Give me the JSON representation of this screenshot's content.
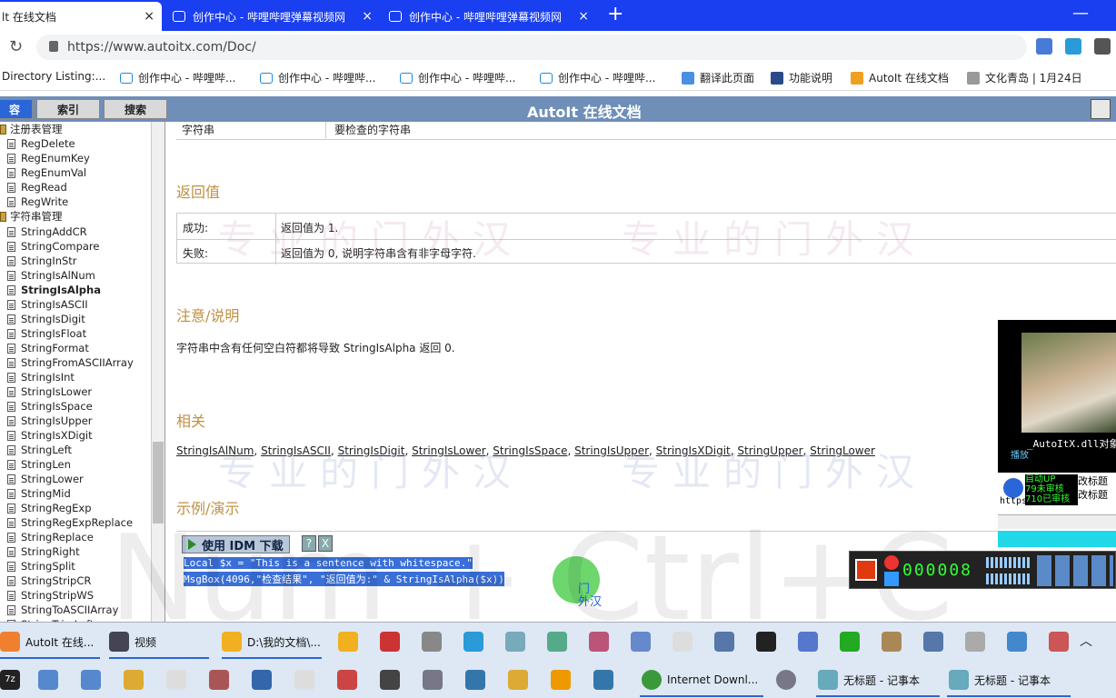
{
  "browser": {
    "tabs": [
      {
        "label": "lt 在线文档",
        "active": true
      },
      {
        "label": "创作中心 - 哔哩哔哩弹幕视频网",
        "active": false
      },
      {
        "label": "创作中心 - 哔哩哔哩弹幕视频网",
        "active": false
      }
    ],
    "new_tab": "+",
    "close": "×",
    "minimize": "—",
    "url": "https://www.autoitx.com/Doc/",
    "bookmarks": [
      "Directory Listing:...",
      "创作中心 - 哔哩哔...",
      "创作中心 - 哔哩哔...",
      "创作中心 - 哔哩哔...",
      "创作中心 - 哔哩哔...",
      "翻译此页面",
      "功能说明",
      "AutoIt 在线文档",
      "文化青岛 | 1月24日"
    ]
  },
  "help": {
    "title": "AutoIt 在线文档",
    "tabs": [
      "容",
      "索引",
      "搜索"
    ],
    "sidebar": {
      "category1": "注册表管理",
      "items1": [
        "RegDelete",
        "RegEnumKey",
        "RegEnumVal",
        "RegRead",
        "RegWrite"
      ],
      "category2": "字符串管理",
      "items2": [
        "StringAddCR",
        "StringCompare",
        "StringInStr",
        "StringIsAlNum",
        "StringIsAlpha",
        "StringIsASCII",
        "StringIsDigit",
        "StringIsFloat",
        "StringFormat",
        "StringFromASCIIArray",
        "StringIsInt",
        "StringIsLower",
        "StringIsSpace",
        "StringIsUpper",
        "StringIsXDigit",
        "StringLeft",
        "StringLen",
        "StringLower",
        "StringMid",
        "StringRegExp",
        "StringRegExpReplace",
        "StringReplace",
        "StringRight",
        "StringSplit",
        "StringStripCR",
        "StringStripWS",
        "StringToASCIIArray",
        "StringTrimLeft"
      ],
      "selected": "StringIsAlpha"
    },
    "param_name": "字符串",
    "param_desc": "要检查的字符串",
    "return_heading": "返回值",
    "success_label": "成功:",
    "success_text": "返回值为 1.",
    "failure_label": "失败:",
    "failure_text": "返回值为 0, 说明字符串含有非字母字符.",
    "notes_heading": "注意/说明",
    "notes_text": "字符串中含有任何空白符都将导致 StringIsAlpha 返回 0.",
    "related_heading": "相关",
    "related_links": [
      "StringIsAlNum",
      "StringIsASCII",
      "StringIsDigit",
      "StringIsLower",
      "StringIsSpace",
      "StringIsUpper",
      "StringIsXDigit",
      "StringUpper",
      "StringLower"
    ],
    "example_heading": "示例/演示",
    "idm_button": "使用 IDM 下载",
    "idm_help": "?",
    "idm_close": "X",
    "code_lines": [
      "Local $x = \"This is a sentence with whitespace.\"",
      "MsgBox(4096,\"检查结果\", \"返回值为:\" & StringIsAlpha($x))"
    ],
    "watermark": "专业的门外汉",
    "cursor_label_1": "门",
    "cursor_label_2": "外汉"
  },
  "overlay": {
    "big_watermark": "Num + Ctrl+C",
    "video_caption": "_AutoItX.dll对象",
    "video_label": "播放",
    "video_url_prefix": "https",
    "video_green_1": "自动UP",
    "video_green_2": "79未审核",
    "video_green_3": "710已审核",
    "video_btn_1": "改标题",
    "video_btn_2": "改标题",
    "recorder_time": "000008"
  },
  "taskbar": {
    "row1": [
      "AutoIt 在线...",
      "视频",
      "D:\\我的文档\\..."
    ],
    "row2_first": "7z",
    "row2": [
      "Internet Downl...",
      "无标题 - 记事本",
      "无标题 - 记事本"
    ]
  }
}
